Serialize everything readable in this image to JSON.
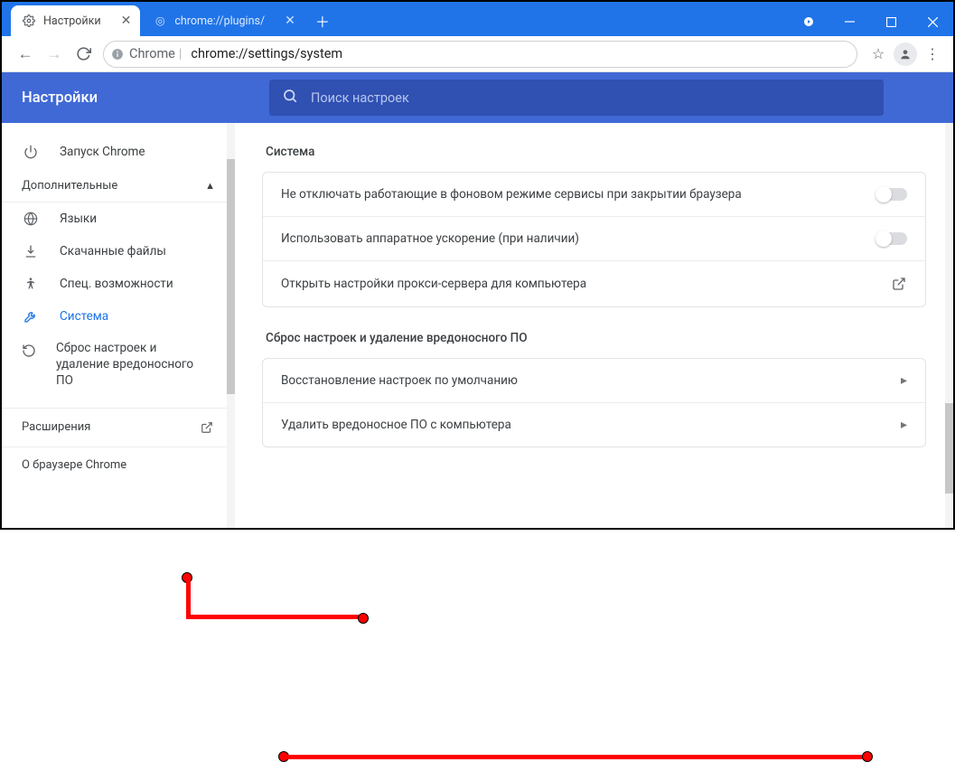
{
  "window": {
    "tabs": [
      {
        "label": "Настройки",
        "icon": "gear"
      },
      {
        "label": "chrome://plugins/",
        "icon": "chrome"
      }
    ]
  },
  "addressbar": {
    "prefix": "Chrome",
    "url": "chrome://settings/system"
  },
  "settings": {
    "title": "Настройки",
    "search_placeholder": "Поиск настроек",
    "sidebar": {
      "items_top": [
        {
          "label": "Запуск Chrome",
          "icon": "power"
        }
      ],
      "advanced_label": "Дополнительные",
      "items_adv": [
        {
          "label": "Языки",
          "icon": "globe"
        },
        {
          "label": "Скачанные файлы",
          "icon": "download"
        },
        {
          "label": "Спец. возможности",
          "icon": "accessibility"
        },
        {
          "label": "Система",
          "icon": "wrench"
        },
        {
          "label": "Сброс настроек и удаление вредоносного ПО",
          "icon": "restore"
        }
      ],
      "extensions_label": "Расширения",
      "about_label": "О браузере Chrome"
    },
    "main": {
      "section1_title": "Система",
      "rows1": [
        "Не отключать работающие в фоновом режиме сервисы при закрытии браузера",
        "Использовать аппаратное ускорение (при наличии)",
        "Открыть настройки прокси-сервера для компьютера"
      ],
      "section2_title": "Сброс настроек и удаление вредоносного ПО",
      "rows2": [
        "Восстановление настроек по умолчанию",
        "Удалить вредоносное ПО с компьютера"
      ]
    }
  }
}
